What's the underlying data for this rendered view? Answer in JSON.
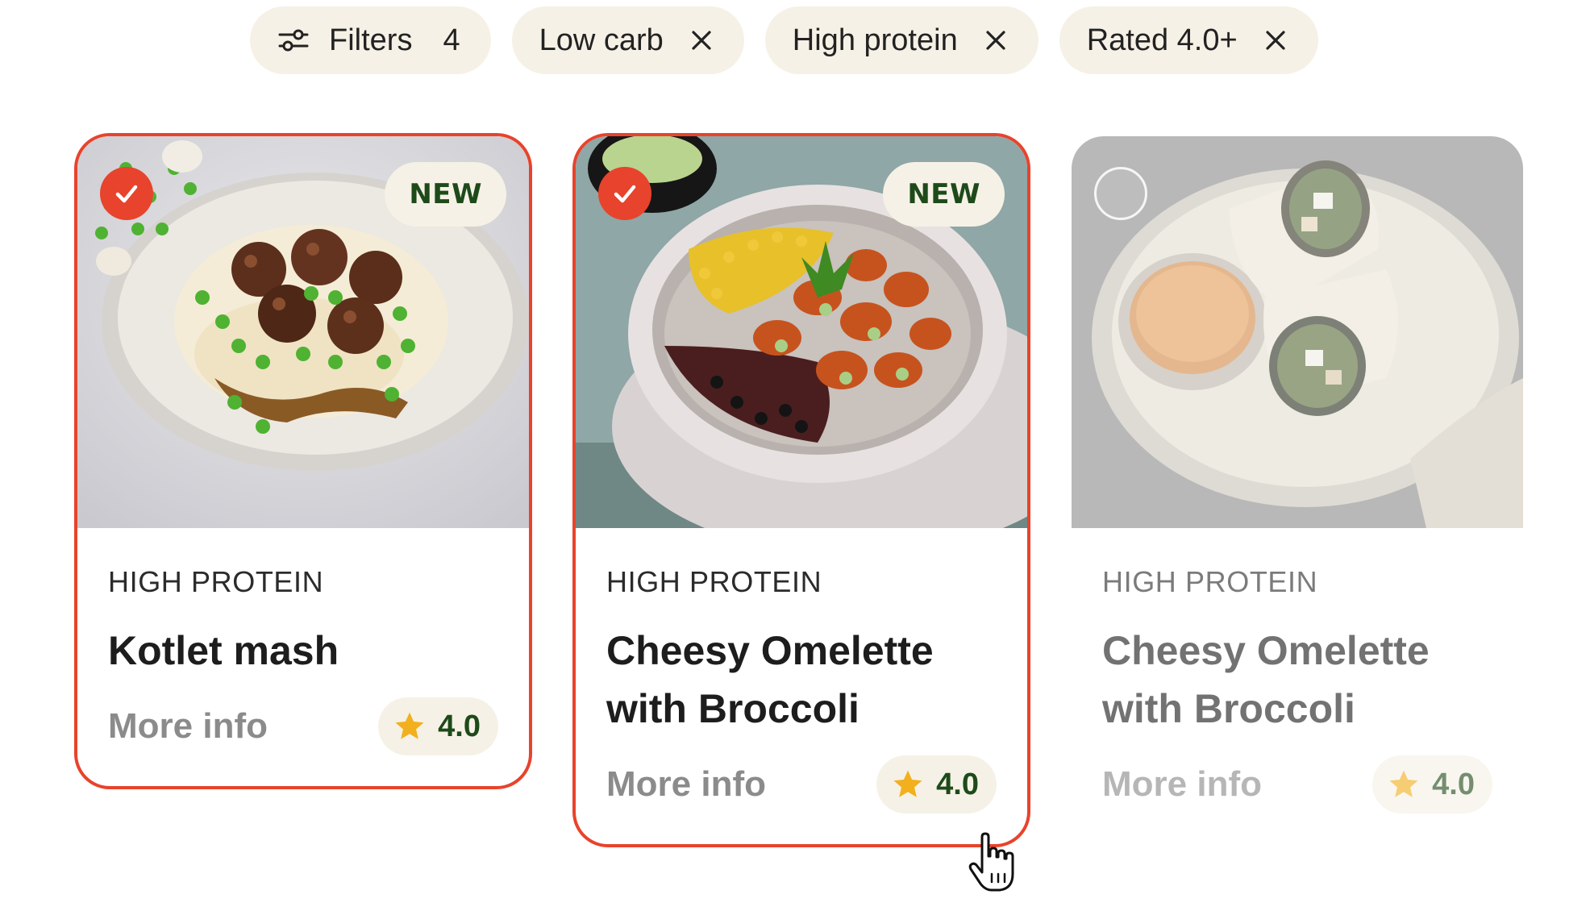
{
  "filters": [
    {
      "label": "Filters",
      "count": "4",
      "icon": "sliders-icon",
      "removable": false
    },
    {
      "label": "Low carb",
      "icon": "close-icon",
      "removable": true
    },
    {
      "label": "High protein",
      "icon": "close-icon",
      "removable": true
    },
    {
      "label": "Rated 4.0+",
      "icon": "close-icon",
      "removable": true
    }
  ],
  "cards": [
    {
      "selected": true,
      "badge": "NEW",
      "category": "HIGH PROTEIN",
      "title": "Kotlet mash",
      "more_info": "More info",
      "rating": "4.0",
      "photo": "meatballs-mash-photo"
    },
    {
      "selected": true,
      "badge": "NEW",
      "category": "HIGH PROTEIN",
      "title": "Cheesy Omelette with Broccoli",
      "more_info": "More info",
      "rating": "4.0",
      "photo": "shrimp-bowl-photo"
    },
    {
      "selected": false,
      "badge": "",
      "category": "HIGH PROTEIN",
      "title": "Cheesy Omelette with Broccoli",
      "more_info": "More info",
      "rating": "4.0",
      "photo": "wrap-plate-photo"
    }
  ],
  "colors": {
    "accent": "#e8432c",
    "chip_bg": "#f6f1e6",
    "badge_text": "#1e4a1a",
    "star": "#f2b01e"
  }
}
